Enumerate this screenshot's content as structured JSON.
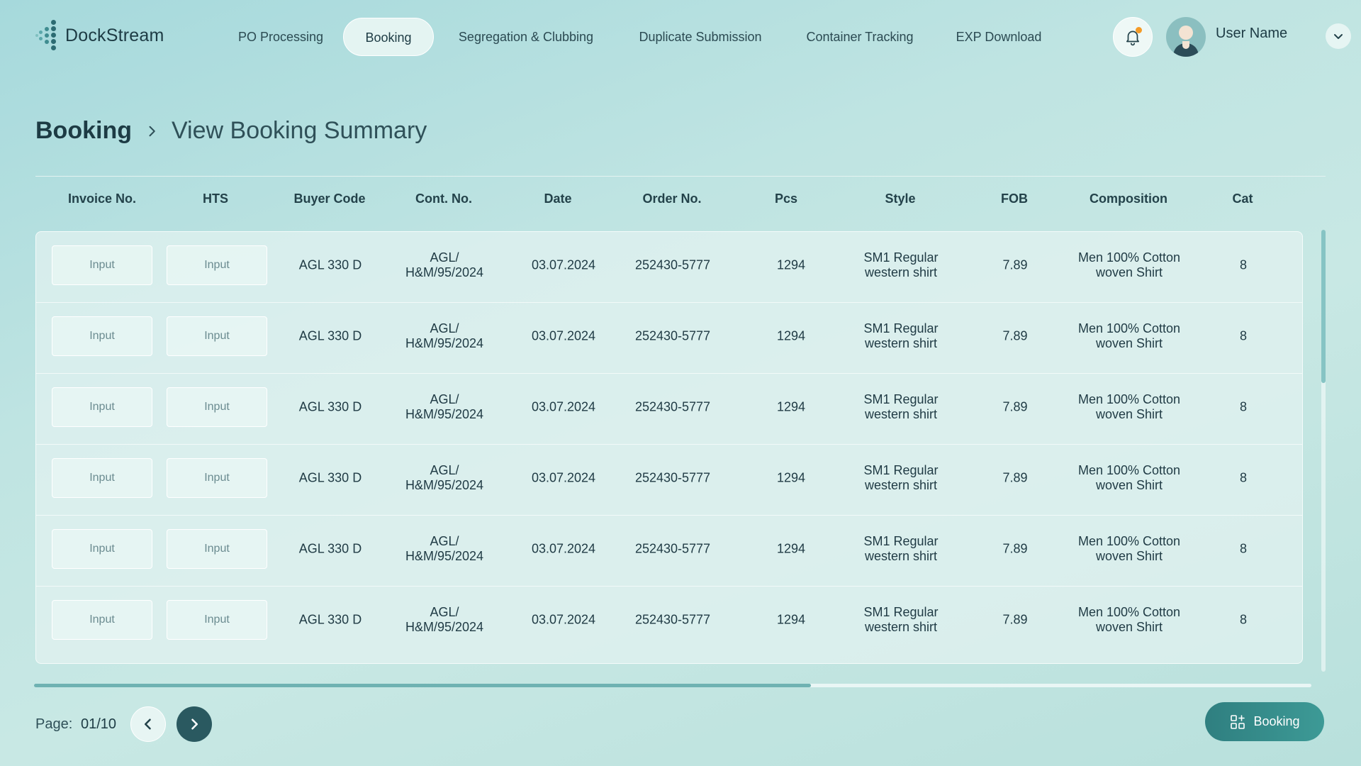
{
  "app": {
    "name": "DockStream"
  },
  "nav": {
    "items": [
      {
        "label": "PO Processing",
        "active": false
      },
      {
        "label": "Booking",
        "active": true
      },
      {
        "label": "Segregation & Clubbing",
        "active": false
      },
      {
        "label": "Duplicate Submission",
        "active": false
      },
      {
        "label": "Container Tracking",
        "active": false
      },
      {
        "label": "EXP Download",
        "active": false
      }
    ]
  },
  "user": {
    "name": "User Name",
    "notification_dot_color": "#f59b26"
  },
  "breadcrumb": {
    "root": "Booking",
    "current": "View Booking Summary"
  },
  "table": {
    "columns": [
      "Invoice No.",
      "HTS",
      "Buyer Code",
      "Cont. No.",
      "Date",
      "Order No.",
      "Pcs",
      "Style",
      "FOB",
      "Composition",
      "Cat"
    ],
    "input_placeholder": "Input",
    "rows": [
      {
        "buyer_code": "AGL 330 D",
        "cont_no_1": "AGL/",
        "cont_no_2": "H&M/95/2024",
        "date": "03.07.2024",
        "order_no": "252430-5777",
        "pcs": "1294",
        "style_1": "SM1 Regular",
        "style_2": "western shirt",
        "fob": "7.89",
        "composition_1": "Men 100% Cotton",
        "composition_2": "woven Shirt",
        "cat": "8"
      },
      {
        "buyer_code": "AGL 330 D",
        "cont_no_1": "AGL/",
        "cont_no_2": "H&M/95/2024",
        "date": "03.07.2024",
        "order_no": "252430-5777",
        "pcs": "1294",
        "style_1": "SM1 Regular",
        "style_2": "western shirt",
        "fob": "7.89",
        "composition_1": "Men 100% Cotton",
        "composition_2": "woven Shirt",
        "cat": "8"
      },
      {
        "buyer_code": "AGL 330 D",
        "cont_no_1": "AGL/",
        "cont_no_2": "H&M/95/2024",
        "date": "03.07.2024",
        "order_no": "252430-5777",
        "pcs": "1294",
        "style_1": "SM1 Regular",
        "style_2": "western shirt",
        "fob": "7.89",
        "composition_1": "Men 100% Cotton",
        "composition_2": "woven Shirt",
        "cat": "8"
      },
      {
        "buyer_code": "AGL 330 D",
        "cont_no_1": "AGL/",
        "cont_no_2": "H&M/95/2024",
        "date": "03.07.2024",
        "order_no": "252430-5777",
        "pcs": "1294",
        "style_1": "SM1 Regular",
        "style_2": "western shirt",
        "fob": "7.89",
        "composition_1": "Men 100% Cotton",
        "composition_2": "woven Shirt",
        "cat": "8"
      },
      {
        "buyer_code": "AGL 330 D",
        "cont_no_1": "AGL/",
        "cont_no_2": "H&M/95/2024",
        "date": "03.07.2024",
        "order_no": "252430-5777",
        "pcs": "1294",
        "style_1": "SM1 Regular",
        "style_2": "western shirt",
        "fob": "7.89",
        "composition_1": "Men 100% Cotton",
        "composition_2": "woven Shirt",
        "cat": "8"
      },
      {
        "buyer_code": "AGL 330 D",
        "cont_no_1": "AGL/",
        "cont_no_2": "H&M/95/2024",
        "date": "03.07.2024",
        "order_no": "252430-5777",
        "pcs": "1294",
        "style_1": "SM1 Regular",
        "style_2": "western shirt",
        "fob": "7.89",
        "composition_1": "Men 100% Cotton",
        "composition_2": "woven Shirt",
        "cat": "8"
      }
    ]
  },
  "pagination": {
    "label": "Page:",
    "value": "01/10"
  },
  "actions": {
    "booking_label": "Booking"
  },
  "icons": {
    "logo": "dockstream-logo-icon",
    "bell": "bell-icon",
    "avatar": "user-avatar-icon",
    "chevron_down": "chevron-down-icon",
    "breadcrumb_separator": "chevron-right-icon",
    "prev": "chevron-left-icon",
    "next": "chevron-right-icon",
    "booking": "grid-plus-icon"
  }
}
